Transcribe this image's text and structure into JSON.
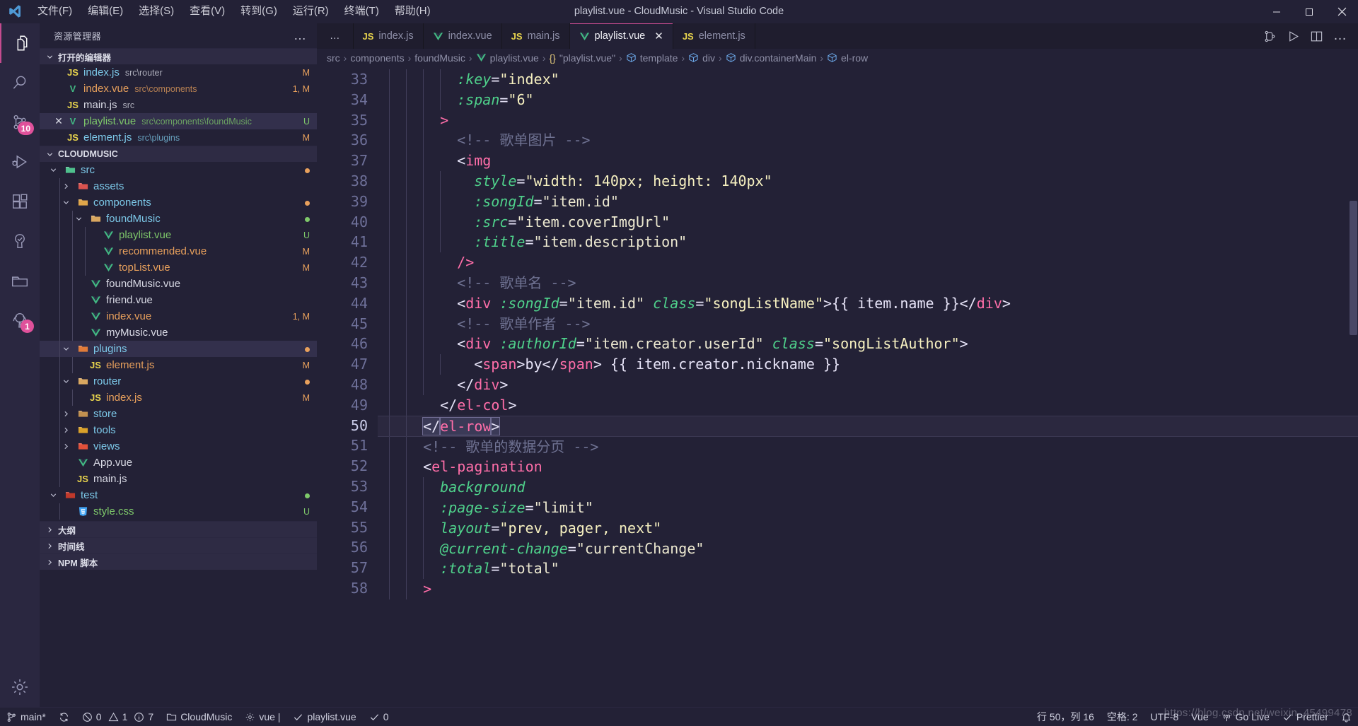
{
  "titlebar": {
    "title": "playlist.vue - CloudMusic - Visual Studio Code",
    "menus": [
      "文件(F)",
      "编辑(E)",
      "选择(S)",
      "查看(V)",
      "转到(G)",
      "运行(R)",
      "终端(T)",
      "帮助(H)"
    ],
    "window_controls": [
      "minimize",
      "maximize",
      "close"
    ]
  },
  "activitybar": {
    "items": [
      {
        "name": "explorer",
        "icon": "files-icon",
        "active": true,
        "badge": ""
      },
      {
        "name": "search",
        "icon": "search-icon",
        "active": false,
        "badge": ""
      },
      {
        "name": "source-control",
        "icon": "source-control-icon",
        "active": false,
        "badge": "10"
      },
      {
        "name": "run-and-debug",
        "icon": "debug-icon",
        "active": false,
        "badge": ""
      },
      {
        "name": "extensions",
        "icon": "extensions-icon",
        "active": false,
        "badge": ""
      },
      {
        "name": "testing",
        "icon": "beaker-icon",
        "active": false,
        "badge": ""
      },
      {
        "name": "remote-explorer",
        "icon": "folder-remote-icon",
        "active": false,
        "badge": ""
      },
      {
        "name": "todo-tree",
        "icon": "tree-icon",
        "active": false,
        "badge": "1"
      },
      {
        "name": "settings",
        "icon": "gear-icon",
        "active": false,
        "badge": ""
      }
    ]
  },
  "sidebar": {
    "title": "资源管理器",
    "more_actions": "…",
    "open_editors": {
      "label": "打开的编辑器",
      "expanded": true,
      "items": [
        {
          "icon": "js",
          "name": "index.js",
          "desc": "src\\router",
          "status": "M",
          "closable": false,
          "selected": false
        },
        {
          "icon": "vue",
          "name": "index.vue",
          "desc": "src\\components",
          "status": "1, M",
          "closable": false,
          "selected": false
        },
        {
          "icon": "js",
          "name": "main.js",
          "desc": "src",
          "status": "",
          "closable": false,
          "selected": false
        },
        {
          "icon": "vue",
          "name": "playlist.vue",
          "desc": "src\\components\\foundMusic",
          "status": "U",
          "closable": true,
          "selected": true
        },
        {
          "icon": "js",
          "name": "element.js",
          "desc": "src\\plugins",
          "status": "M",
          "closable": false,
          "selected": false
        }
      ]
    },
    "workspace": {
      "label": "CLOUDMUSIC",
      "expanded": true,
      "tree": [
        {
          "depth": 1,
          "type": "folder",
          "twisty": "down",
          "icon": "folder-src",
          "name": "src",
          "status": "dot",
          "selected": false
        },
        {
          "depth": 2,
          "type": "folder",
          "twisty": "right",
          "icon": "folder-assets",
          "name": "assets",
          "status": "",
          "selected": false
        },
        {
          "depth": 2,
          "type": "folder",
          "twisty": "down",
          "icon": "folder-components",
          "name": "components",
          "status": "dot",
          "selected": false
        },
        {
          "depth": 3,
          "type": "folder",
          "twisty": "down",
          "icon": "folder-open",
          "name": "foundMusic",
          "status": "dot-green",
          "selected": false
        },
        {
          "depth": 4,
          "type": "file",
          "twisty": "",
          "icon": "vue",
          "name": "playlist.vue",
          "status": "U",
          "selected": false
        },
        {
          "depth": 4,
          "type": "file",
          "twisty": "",
          "icon": "vue",
          "name": "recommended.vue",
          "status": "M",
          "selected": false
        },
        {
          "depth": 4,
          "type": "file",
          "twisty": "",
          "icon": "vue",
          "name": "topList.vue",
          "status": "M",
          "selected": false
        },
        {
          "depth": 3,
          "type": "file",
          "twisty": "",
          "icon": "vue",
          "name": "foundMusic.vue",
          "status": "",
          "selected": false
        },
        {
          "depth": 3,
          "type": "file",
          "twisty": "",
          "icon": "vue",
          "name": "friend.vue",
          "status": "",
          "selected": false
        },
        {
          "depth": 3,
          "type": "file",
          "twisty": "",
          "icon": "vue",
          "name": "index.vue",
          "status": "1, M",
          "selected": false
        },
        {
          "depth": 3,
          "type": "file",
          "twisty": "",
          "icon": "vue",
          "name": "myMusic.vue",
          "status": "",
          "selected": false
        },
        {
          "depth": 2,
          "type": "folder",
          "twisty": "down",
          "icon": "folder-plugins",
          "name": "plugins",
          "status": "dot",
          "selected": true
        },
        {
          "depth": 3,
          "type": "file",
          "twisty": "",
          "icon": "js",
          "name": "element.js",
          "status": "M",
          "selected": false
        },
        {
          "depth": 2,
          "type": "folder",
          "twisty": "down",
          "icon": "folder-open",
          "name": "router",
          "status": "dot",
          "selected": false
        },
        {
          "depth": 3,
          "type": "file",
          "twisty": "",
          "icon": "js",
          "name": "index.js",
          "status": "M",
          "selected": false
        },
        {
          "depth": 2,
          "type": "folder",
          "twisty": "right",
          "icon": "folder-closed",
          "name": "store",
          "status": "",
          "selected": false
        },
        {
          "depth": 2,
          "type": "folder",
          "twisty": "right",
          "icon": "folder-tools",
          "name": "tools",
          "status": "",
          "selected": false
        },
        {
          "depth": 2,
          "type": "folder",
          "twisty": "right",
          "icon": "folder-views",
          "name": "views",
          "status": "",
          "selected": false
        },
        {
          "depth": 2,
          "type": "file",
          "twisty": "",
          "icon": "vue",
          "name": "App.vue",
          "status": "",
          "selected": false
        },
        {
          "depth": 2,
          "type": "file",
          "twisty": "",
          "icon": "js",
          "name": "main.js",
          "status": "",
          "selected": false
        },
        {
          "depth": 1,
          "type": "folder",
          "twisty": "down",
          "icon": "folder-test",
          "name": "test",
          "status": "dot-green",
          "selected": false
        },
        {
          "depth": 2,
          "type": "file",
          "twisty": "",
          "icon": "css",
          "name": "style.css",
          "status": "U",
          "selected": false
        }
      ]
    },
    "collapsed_sections": [
      {
        "label": "大纲"
      },
      {
        "label": "时间线"
      },
      {
        "label": "NPM 脚本"
      }
    ]
  },
  "editor": {
    "tabs_overflow": "…",
    "tabs": [
      {
        "icon": "js",
        "label": "index.js",
        "active": false,
        "dirty": false
      },
      {
        "icon": "vue",
        "label": "index.vue",
        "active": false,
        "dirty": false
      },
      {
        "icon": "js",
        "label": "main.js",
        "active": false,
        "dirty": false
      },
      {
        "icon": "vue",
        "label": "playlist.vue",
        "active": true,
        "dirty": false
      },
      {
        "icon": "js",
        "label": "element.js",
        "active": false,
        "dirty": false
      }
    ],
    "tab_actions": [
      "split-editor-vertical-icon",
      "run-icon",
      "split-editor-icon",
      "more-actions-icon"
    ],
    "breadcrumb": [
      {
        "icon": "",
        "label": "src"
      },
      {
        "icon": "",
        "label": "components"
      },
      {
        "icon": "",
        "label": "foundMusic"
      },
      {
        "icon": "vue",
        "label": "playlist.vue"
      },
      {
        "icon": "braces",
        "label": "\"playlist.vue\""
      },
      {
        "icon": "symbol",
        "label": "template"
      },
      {
        "icon": "symbol",
        "label": "div"
      },
      {
        "icon": "symbol",
        "label": "div.containerMain"
      },
      {
        "icon": "symbol",
        "label": "el-row"
      }
    ],
    "first_line_number": 33,
    "lines": [
      {
        "n": 33,
        "guides": 4,
        "indent": 4,
        "tokens": [
          {
            "t": "attr",
            "v": ":key"
          },
          {
            "t": "punc",
            "v": "="
          },
          {
            "t": "str",
            "v": "\"index\""
          }
        ]
      },
      {
        "n": 34,
        "guides": 4,
        "indent": 4,
        "tokens": [
          {
            "t": "attr",
            "v": ":span"
          },
          {
            "t": "punc",
            "v": "="
          },
          {
            "t": "str",
            "v": "\"6\""
          }
        ]
      },
      {
        "n": 35,
        "guides": 3,
        "indent": 3,
        "tokens": [
          {
            "t": "tag",
            "v": ">"
          }
        ]
      },
      {
        "n": 36,
        "guides": 3,
        "indent": 4,
        "tokens": [
          {
            "t": "com",
            "v": "<!-- 歌单图片 -->"
          }
        ]
      },
      {
        "n": 37,
        "guides": 3,
        "indent": 4,
        "tokens": [
          {
            "t": "punc",
            "v": "<"
          },
          {
            "t": "tag",
            "v": "img"
          }
        ]
      },
      {
        "n": 38,
        "guides": 4,
        "indent": 5,
        "tokens": [
          {
            "t": "attr",
            "v": "style"
          },
          {
            "t": "punc",
            "v": "="
          },
          {
            "t": "str",
            "v": "\"width: 140px; height: 140px\""
          }
        ]
      },
      {
        "n": 39,
        "guides": 4,
        "indent": 5,
        "tokens": [
          {
            "t": "attr",
            "v": ":songId"
          },
          {
            "t": "punc",
            "v": "="
          },
          {
            "t": "str2",
            "v": "\"item.id\""
          }
        ]
      },
      {
        "n": 40,
        "guides": 4,
        "indent": 5,
        "tokens": [
          {
            "t": "attr",
            "v": ":src"
          },
          {
            "t": "punc",
            "v": "="
          },
          {
            "t": "str2",
            "v": "\"item.coverImgUrl\""
          }
        ]
      },
      {
        "n": 41,
        "guides": 4,
        "indent": 5,
        "tokens": [
          {
            "t": "attr",
            "v": ":title"
          },
          {
            "t": "punc",
            "v": "="
          },
          {
            "t": "str2",
            "v": "\"item.description\""
          }
        ]
      },
      {
        "n": 42,
        "guides": 3,
        "indent": 4,
        "tokens": [
          {
            "t": "tag",
            "v": "/>"
          }
        ]
      },
      {
        "n": 43,
        "guides": 3,
        "indent": 4,
        "tokens": [
          {
            "t": "com",
            "v": "<!-- 歌单名 -->"
          }
        ]
      },
      {
        "n": 44,
        "guides": 3,
        "indent": 4,
        "tokens": [
          {
            "t": "punc",
            "v": "<"
          },
          {
            "t": "tag",
            "v": "div"
          },
          {
            "t": "plain",
            "v": " "
          },
          {
            "t": "attr",
            "v": ":songId"
          },
          {
            "t": "punc",
            "v": "="
          },
          {
            "t": "str2",
            "v": "\"item.id\""
          },
          {
            "t": "plain",
            "v": " "
          },
          {
            "t": "attr",
            "v": "class"
          },
          {
            "t": "punc",
            "v": "="
          },
          {
            "t": "str",
            "v": "\"songListName\""
          },
          {
            "t": "punc",
            "v": ">"
          },
          {
            "t": "plain",
            "v": "{{ item.name }}"
          },
          {
            "t": "punc",
            "v": "</"
          },
          {
            "t": "tag",
            "v": "div"
          },
          {
            "t": "punc",
            "v": ">"
          }
        ]
      },
      {
        "n": 45,
        "guides": 3,
        "indent": 4,
        "tokens": [
          {
            "t": "com",
            "v": "<!-- 歌单作者 -->"
          }
        ]
      },
      {
        "n": 46,
        "guides": 3,
        "indent": 4,
        "tokens": [
          {
            "t": "punc",
            "v": "<"
          },
          {
            "t": "tag",
            "v": "div"
          },
          {
            "t": "plain",
            "v": " "
          },
          {
            "t": "attr",
            "v": ":authorId"
          },
          {
            "t": "punc",
            "v": "="
          },
          {
            "t": "str2",
            "v": "\"item.creator.userId\""
          },
          {
            "t": "plain",
            "v": " "
          },
          {
            "t": "attr",
            "v": "class"
          },
          {
            "t": "punc",
            "v": "="
          },
          {
            "t": "str",
            "v": "\"songListAuthor\""
          },
          {
            "t": "punc",
            "v": ">"
          }
        ]
      },
      {
        "n": 47,
        "guides": 4,
        "indent": 5,
        "tokens": [
          {
            "t": "punc",
            "v": "<"
          },
          {
            "t": "tag",
            "v": "span"
          },
          {
            "t": "punc",
            "v": ">"
          },
          {
            "t": "plain",
            "v": "by"
          },
          {
            "t": "punc",
            "v": "</"
          },
          {
            "t": "tag",
            "v": "span"
          },
          {
            "t": "punc",
            "v": ">"
          },
          {
            "t": "plain",
            "v": " {{ item.creator.nickname }}"
          }
        ]
      },
      {
        "n": 48,
        "guides": 3,
        "indent": 4,
        "tokens": [
          {
            "t": "punc",
            "v": "</"
          },
          {
            "t": "tag",
            "v": "div"
          },
          {
            "t": "punc",
            "v": ">"
          }
        ]
      },
      {
        "n": 49,
        "guides": 2,
        "indent": 3,
        "tokens": [
          {
            "t": "punc",
            "v": "</"
          },
          {
            "t": "tag",
            "v": "el-col"
          },
          {
            "t": "punc",
            "v": ">"
          }
        ]
      },
      {
        "n": 50,
        "guides": 2,
        "indent": 2,
        "highlight": true,
        "cursor": true,
        "tokens": [
          {
            "t": "punc",
            "v": "</"
          },
          {
            "t": "tag",
            "v": "el-row"
          },
          {
            "t": "punc",
            "v": ">"
          }
        ]
      },
      {
        "n": 51,
        "guides": 2,
        "indent": 2,
        "tokens": [
          {
            "t": "com",
            "v": "<!-- 歌单的数据分页 -->"
          }
        ]
      },
      {
        "n": 52,
        "guides": 2,
        "indent": 2,
        "tokens": [
          {
            "t": "punc",
            "v": "<"
          },
          {
            "t": "tag",
            "v": "el-pagination"
          }
        ]
      },
      {
        "n": 53,
        "guides": 3,
        "indent": 3,
        "tokens": [
          {
            "t": "attr",
            "v": "background"
          }
        ]
      },
      {
        "n": 54,
        "guides": 3,
        "indent": 3,
        "tokens": [
          {
            "t": "attr",
            "v": ":page-size"
          },
          {
            "t": "punc",
            "v": "="
          },
          {
            "t": "str2",
            "v": "\"limit\""
          }
        ]
      },
      {
        "n": 55,
        "guides": 3,
        "indent": 3,
        "tokens": [
          {
            "t": "attr",
            "v": "layout"
          },
          {
            "t": "punc",
            "v": "="
          },
          {
            "t": "str",
            "v": "\"prev, pager, next\""
          }
        ]
      },
      {
        "n": 56,
        "guides": 3,
        "indent": 3,
        "tokens": [
          {
            "t": "attr",
            "v": "@current-change"
          },
          {
            "t": "punc",
            "v": "="
          },
          {
            "t": "str2",
            "v": "\"currentChange\""
          }
        ]
      },
      {
        "n": 57,
        "guides": 3,
        "indent": 3,
        "tokens": [
          {
            "t": "attr",
            "v": ":total"
          },
          {
            "t": "punc",
            "v": "="
          },
          {
            "t": "str2",
            "v": "\"total\""
          }
        ]
      },
      {
        "n": 58,
        "guides": 2,
        "indent": 2,
        "tokens": [
          {
            "t": "tag",
            "v": ">"
          }
        ]
      }
    ]
  },
  "statusbar": {
    "left": [
      {
        "name": "remote-branch",
        "icon": "git-branch-icon",
        "text": "main*"
      },
      {
        "name": "sync-changes",
        "icon": "sync-icon",
        "text": ""
      },
      {
        "name": "problems",
        "icon": "errors-warnings",
        "text": "0  1  7",
        "errors": "0",
        "warnings": "1",
        "infos": "7"
      },
      {
        "name": "folder",
        "icon": "folder-icon",
        "text": "CloudMusic"
      },
      {
        "name": "vue-language",
        "icon": "gear-icon",
        "text": "vue |"
      },
      {
        "name": "file-status",
        "icon": "check-icon",
        "text": "playlist.vue"
      },
      {
        "name": "tasks",
        "icon": "check-icon",
        "text": "0"
      }
    ],
    "right": [
      {
        "name": "cursor-position",
        "text": "行 50，列 16"
      },
      {
        "name": "indentation",
        "text": "空格: 2"
      },
      {
        "name": "encoding",
        "text": "UTF-8"
      },
      {
        "name": "language-mode",
        "text": "Vue"
      },
      {
        "name": "go-live",
        "icon": "broadcast-icon",
        "text": "Go Live"
      },
      {
        "name": "prettier",
        "icon": "check-icon",
        "text": "Prettier"
      },
      {
        "name": "notifications",
        "icon": "bell-icon",
        "text": ""
      }
    ]
  },
  "watermark": "https://blog.csdn.net/weixin_45499478"
}
